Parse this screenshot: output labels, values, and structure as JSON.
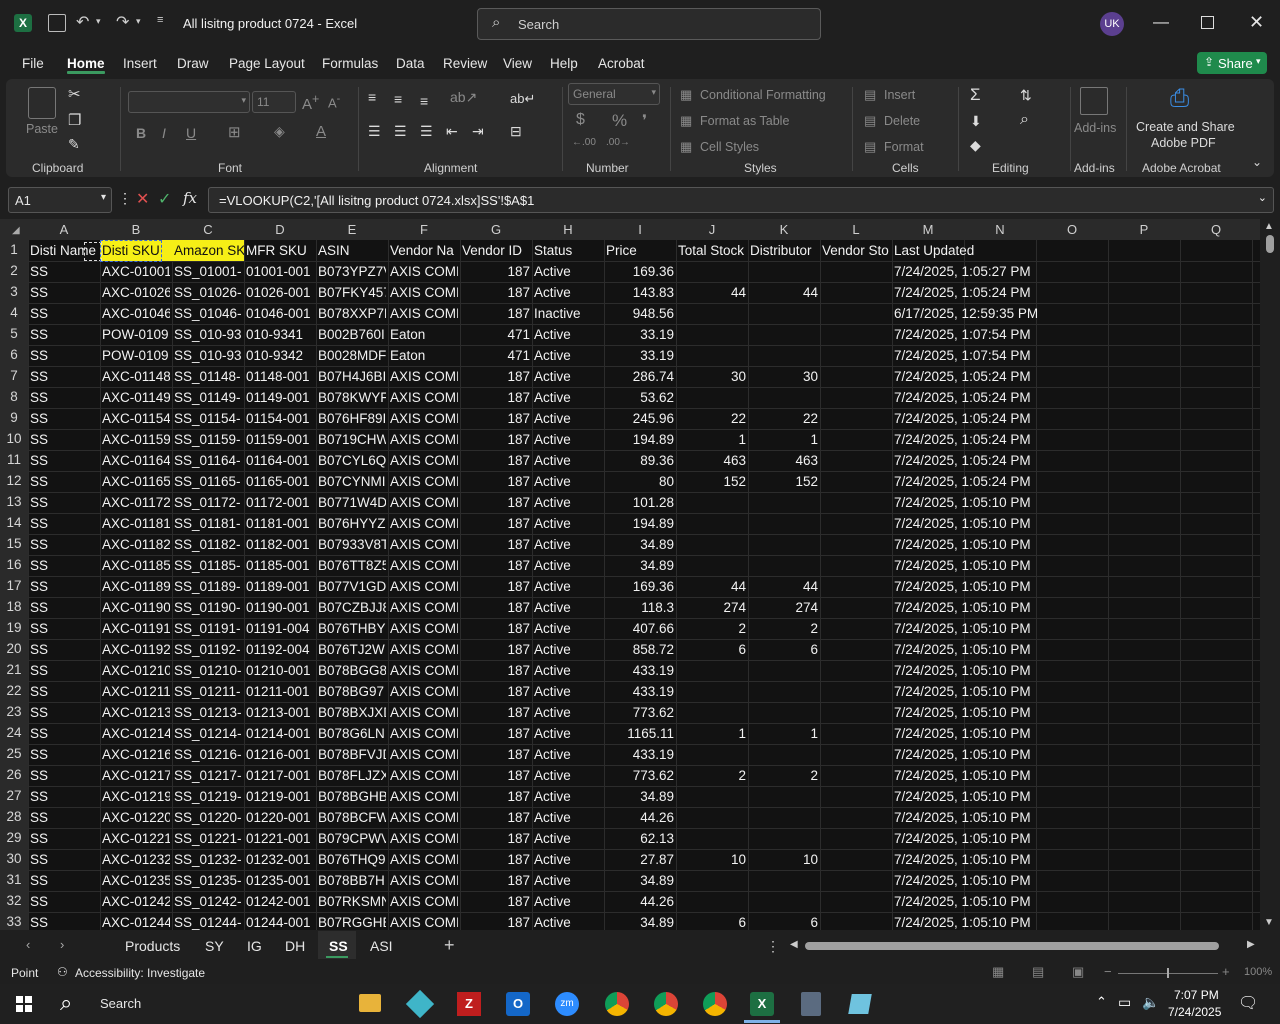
{
  "window": {
    "title": "All lisitng product 0724  -  Excel",
    "search_label": "Search",
    "user_initials": "UK"
  },
  "menu": {
    "tabs": [
      "File",
      "Home",
      "Insert",
      "Draw",
      "Page Layout",
      "Formulas",
      "Data",
      "Review",
      "View",
      "Help",
      "Acrobat"
    ],
    "active": "Home",
    "share_label": "Share"
  },
  "ribbon": {
    "clipboard": {
      "label": "Clipboard",
      "paste": "Paste"
    },
    "font": {
      "label": "Font",
      "size": "11",
      "bold": "B",
      "italic": "I",
      "underline": "U"
    },
    "alignment": {
      "label": "Alignment"
    },
    "number": {
      "label": "Number",
      "format": "General",
      "currency": "$",
      "percent": "%"
    },
    "styles": {
      "label": "Styles",
      "conditional": "Conditional Formatting",
      "format_table": "Format as Table",
      "cell_styles": "Cell Styles"
    },
    "cells": {
      "label": "Cells",
      "insert": "Insert",
      "delete": "Delete",
      "format": "Format"
    },
    "editing": {
      "label": "Editing"
    },
    "addins": {
      "label": "Add-ins",
      "button": "Add-ins"
    },
    "acrobat": {
      "label": "Adobe Acrobat",
      "button_line1": "Create and Share",
      "button_line2": "Adobe PDF"
    }
  },
  "formula_bar": {
    "name_box": "A1",
    "formula": "=VLOOKUP(C2,'[All lisitng product 0724.xlsx]SS'!$A$1"
  },
  "columns": [
    "A",
    "B",
    "C",
    "D",
    "E",
    "F",
    "G",
    "H",
    "I",
    "J",
    "K",
    "L",
    "M",
    "N",
    "O",
    "P",
    "Q"
  ],
  "header_row": [
    "Disti Name",
    "Disti SKU",
    "Amazon SK",
    "MFR SKU",
    "ASIN",
    "Vendor Na",
    "Vendor ID",
    "Status",
    "Price",
    "Total Stock",
    "Distributor",
    "Vendor Sto",
    "Last Updated"
  ],
  "rows": [
    [
      "SS",
      "AXC-01001",
      "SS_01001-",
      "01001-001",
      "B073YPZ7V",
      "AXIS COMI",
      "187",
      "Active",
      "169.36",
      "",
      "",
      "",
      "7/24/2025, 1:05:27 PM"
    ],
    [
      "SS",
      "AXC-01026",
      "SS_01026-",
      "01026-001",
      "B07FKY457",
      "AXIS COMI",
      "187",
      "Active",
      "143.83",
      "44",
      "44",
      "",
      "7/24/2025, 1:05:24 PM"
    ],
    [
      "SS",
      "AXC-01046",
      "SS_01046-",
      "01046-001",
      "B078XXP7E",
      "AXIS COMI",
      "187",
      "Inactive",
      "948.56",
      "",
      "",
      "",
      "6/17/2025, 12:59:35 PM"
    ],
    [
      "SS",
      "POW-0109",
      "SS_010-93",
      "010-9341",
      "B002B760I",
      "Eaton",
      "471",
      "Active",
      "33.19",
      "",
      "",
      "",
      "7/24/2025, 1:07:54 PM"
    ],
    [
      "SS",
      "POW-0109",
      "SS_010-93",
      "010-9342",
      "B0028MDF",
      "Eaton",
      "471",
      "Active",
      "33.19",
      "",
      "",
      "",
      "7/24/2025, 1:07:54 PM"
    ],
    [
      "SS",
      "AXC-01148",
      "SS_01148-",
      "01148-001",
      "B07H4J6BI",
      "AXIS COMI",
      "187",
      "Active",
      "286.74",
      "30",
      "30",
      "",
      "7/24/2025, 1:05:24 PM"
    ],
    [
      "SS",
      "AXC-01149",
      "SS_01149-",
      "01149-001",
      "B078KWYF",
      "AXIS COMI",
      "187",
      "Active",
      "53.62",
      "",
      "",
      "",
      "7/24/2025, 1:05:24 PM"
    ],
    [
      "SS",
      "AXC-01154",
      "SS_01154-",
      "01154-001",
      "B076HF89I",
      "AXIS COMI",
      "187",
      "Active",
      "245.96",
      "22",
      "22",
      "",
      "7/24/2025, 1:05:24 PM"
    ],
    [
      "SS",
      "AXC-01159",
      "SS_01159-",
      "01159-001",
      "B0719CHW",
      "AXIS COMI",
      "187",
      "Active",
      "194.89",
      "1",
      "1",
      "",
      "7/24/2025, 1:05:24 PM"
    ],
    [
      "SS",
      "AXC-01164",
      "SS_01164-",
      "01164-001",
      "B07CYL6Q",
      "AXIS COMI",
      "187",
      "Active",
      "89.36",
      "463",
      "463",
      "",
      "7/24/2025, 1:05:24 PM"
    ],
    [
      "SS",
      "AXC-01165",
      "SS_01165-",
      "01165-001",
      "B07CYNMI",
      "AXIS COMI",
      "187",
      "Active",
      "80",
      "152",
      "152",
      "",
      "7/24/2025, 1:05:24 PM"
    ],
    [
      "SS",
      "AXC-01172",
      "SS_01172-",
      "01172-001",
      "B0771W4D",
      "AXIS COMI",
      "187",
      "Active",
      "101.28",
      "",
      "",
      "",
      "7/24/2025, 1:05:10 PM"
    ],
    [
      "SS",
      "AXC-01181",
      "SS_01181-",
      "01181-001",
      "B076HYYZ",
      "AXIS COMI",
      "187",
      "Active",
      "194.89",
      "",
      "",
      "",
      "7/24/2025, 1:05:10 PM"
    ],
    [
      "SS",
      "AXC-01182",
      "SS_01182-",
      "01182-001",
      "B07933V8T",
      "AXIS COMI",
      "187",
      "Active",
      "34.89",
      "",
      "",
      "",
      "7/24/2025, 1:05:10 PM"
    ],
    [
      "SS",
      "AXC-01185",
      "SS_01185-",
      "01185-001",
      "B076TT8Z5",
      "AXIS COMI",
      "187",
      "Active",
      "34.89",
      "",
      "",
      "",
      "7/24/2025, 1:05:10 PM"
    ],
    [
      "SS",
      "AXC-01189",
      "SS_01189-",
      "01189-001",
      "B077V1GD",
      "AXIS COMI",
      "187",
      "Active",
      "169.36",
      "44",
      "44",
      "",
      "7/24/2025, 1:05:10 PM"
    ],
    [
      "SS",
      "AXC-01190",
      "SS_01190-",
      "01190-001",
      "B07CZBJJ8",
      "AXIS COMI",
      "187",
      "Active",
      "118.3",
      "274",
      "274",
      "",
      "7/24/2025, 1:05:10 PM"
    ],
    [
      "SS",
      "AXC-01191",
      "SS_01191-",
      "01191-004",
      "B076THBY",
      "AXIS COMI",
      "187",
      "Active",
      "407.66",
      "2",
      "2",
      "",
      "7/24/2025, 1:05:10 PM"
    ],
    [
      "SS",
      "AXC-01192",
      "SS_01192-",
      "01192-004",
      "B076TJ2W",
      "AXIS COMI",
      "187",
      "Active",
      "858.72",
      "6",
      "6",
      "",
      "7/24/2025, 1:05:10 PM"
    ],
    [
      "SS",
      "AXC-01210",
      "SS_01210-",
      "01210-001",
      "B078BGG8",
      "AXIS COMI",
      "187",
      "Active",
      "433.19",
      "",
      "",
      "",
      "7/24/2025, 1:05:10 PM"
    ],
    [
      "SS",
      "AXC-01211",
      "SS_01211-",
      "01211-001",
      "B078BG97",
      "AXIS COMI",
      "187",
      "Active",
      "433.19",
      "",
      "",
      "",
      "7/24/2025, 1:05:10 PM"
    ],
    [
      "SS",
      "AXC-01213",
      "SS_01213-",
      "01213-001",
      "B078BXJXD",
      "AXIS COMI",
      "187",
      "Active",
      "773.62",
      "",
      "",
      "",
      "7/24/2025, 1:05:10 PM"
    ],
    [
      "SS",
      "AXC-01214",
      "SS_01214-",
      "01214-001",
      "B078G6LN",
      "AXIS COMI",
      "187",
      "Active",
      "1165.11",
      "1",
      "1",
      "",
      "7/24/2025, 1:05:10 PM"
    ],
    [
      "SS",
      "AXC-01216",
      "SS_01216-",
      "01216-001",
      "B078BFVJD",
      "AXIS COMI",
      "187",
      "Active",
      "433.19",
      "",
      "",
      "",
      "7/24/2025, 1:05:10 PM"
    ],
    [
      "SS",
      "AXC-01217",
      "SS_01217-",
      "01217-001",
      "B078FLJZX",
      "AXIS COMI",
      "187",
      "Active",
      "773.62",
      "2",
      "2",
      "",
      "7/24/2025, 1:05:10 PM"
    ],
    [
      "SS",
      "AXC-01219",
      "SS_01219-",
      "01219-001",
      "B078BGHB",
      "AXIS COMI",
      "187",
      "Active",
      "34.89",
      "",
      "",
      "",
      "7/24/2025, 1:05:10 PM"
    ],
    [
      "SS",
      "AXC-01220",
      "SS_01220-",
      "01220-001",
      "B078BCFW",
      "AXIS COMI",
      "187",
      "Active",
      "44.26",
      "",
      "",
      "",
      "7/24/2025, 1:05:10 PM"
    ],
    [
      "SS",
      "AXC-01221",
      "SS_01221-",
      "01221-001",
      "B079CPWV",
      "AXIS COMI",
      "187",
      "Active",
      "62.13",
      "",
      "",
      "",
      "7/24/2025, 1:05:10 PM"
    ],
    [
      "SS",
      "AXC-01232",
      "SS_01232-",
      "01232-001",
      "B076THQ9",
      "AXIS COMI",
      "187",
      "Active",
      "27.87",
      "10",
      "10",
      "",
      "7/24/2025, 1:05:10 PM"
    ],
    [
      "SS",
      "AXC-01235",
      "SS_01235-",
      "01235-001",
      "B078BB7H",
      "AXIS COMI",
      "187",
      "Active",
      "34.89",
      "",
      "",
      "",
      "7/24/2025, 1:05:10 PM"
    ],
    [
      "SS",
      "AXC-01242",
      "SS_01242-",
      "01242-001",
      "B07RKSMN",
      "AXIS COMI",
      "187",
      "Active",
      "44.26",
      "",
      "",
      "",
      "7/24/2025, 1:05:10 PM"
    ],
    [
      "SS",
      "AXC-01244",
      "SS_01244-",
      "01244-001",
      "B07RGGHE",
      "AXIS COMI",
      "187",
      "Active",
      "34.89",
      "6",
      "6",
      "",
      "7/24/2025, 1:05:10 PM"
    ]
  ],
  "sheets": [
    "Products",
    "SY",
    "IG",
    "DH",
    "SS",
    "ASI"
  ],
  "active_sheet": "SS",
  "status": {
    "mode": "Point",
    "accessibility": "Accessibility: Investigate",
    "zoom": "100%"
  },
  "taskbar": {
    "search": "Search",
    "time": "7:07 PM",
    "date": "7/24/2025"
  },
  "colors": {
    "accent_green": "#1f8a4c",
    "highlight_yellow": "#f6ef16",
    "avatar": "#5b3f8f"
  }
}
